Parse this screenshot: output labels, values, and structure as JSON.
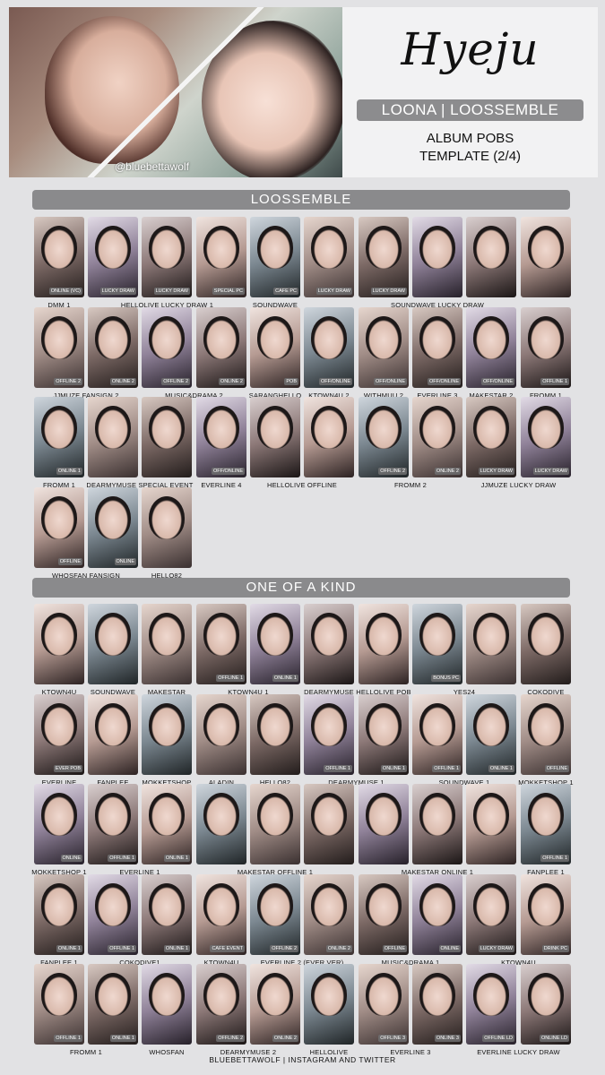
{
  "header": {
    "name": "Hyeju",
    "group": "LOONA | LOOSSEMBLE",
    "subtitle_line1": "ALBUM POBS",
    "subtitle_line2": "TEMPLATE (2/4)",
    "watermark": "@bluebettawolf"
  },
  "sections": [
    {
      "title": "LOOSSEMBLE",
      "rows": [
        {
          "tags": [
            "ONLINE (VC)",
            "LUCKY DRAW",
            "LUCKY DRAW",
            "SPECIAL PC",
            "CAFE PC",
            "LUCKY DRAW",
            "LUCKY DRAW",
            "",
            "",
            ""
          ],
          "labels": [
            {
              "text": "DMM 1",
              "span": [
                0,
                0
              ]
            },
            {
              "text": "HELLOLIVE LUCKY DRAW 1",
              "span": [
                1,
                3
              ]
            },
            {
              "text": "SOUNDWAVE",
              "span": [
                4,
                4
              ]
            },
            {
              "text": "SOUNDWAVE LUCKY DRAW",
              "span": [
                5,
                9
              ]
            }
          ]
        },
        {
          "tags": [
            "OFFLINE 2",
            "ONLINE 2",
            "OFFLINE 2",
            "ONLINE 2",
            "POB",
            "OFF/ONLINE",
            "OFF/ONLINE",
            "OFF/ONLINE",
            "OFF/ONLINE",
            "OFFLINE 1"
          ],
          "labels": [
            {
              "text": "JJMUZE FANSIGN 2",
              "span": [
                0,
                1
              ]
            },
            {
              "text": "MUSIC&DRAMA 2",
              "span": [
                2,
                3
              ]
            },
            {
              "text": "SARANGHELLO",
              "span": [
                4,
                4
              ]
            },
            {
              "text": "KTOWN4U 2",
              "span": [
                5,
                5
              ]
            },
            {
              "text": "WITHMUU 2",
              "span": [
                6,
                6
              ]
            },
            {
              "text": "EVERLINE 3",
              "span": [
                7,
                7
              ]
            },
            {
              "text": "MAKESTAR 2",
              "span": [
                8,
                8
              ]
            },
            {
              "text": "FROMM 1",
              "span": [
                9,
                9
              ]
            }
          ]
        },
        {
          "tags": [
            "ONLINE 1",
            "",
            "",
            "OFF/ONLINE",
            "",
            "",
            "OFFLINE 2",
            "ONLINE 2",
            "LUCKY DRAW",
            "LUCKY DRAW"
          ],
          "labels": [
            {
              "text": "FROMM 1",
              "span": [
                0,
                0
              ]
            },
            {
              "text": "DEARMYMUSE SPECIAL EVENT",
              "span": [
                1,
                2
              ]
            },
            {
              "text": "EVERLINE 4",
              "span": [
                3,
                3
              ]
            },
            {
              "text": "HELLOLIVE OFFLINE",
              "span": [
                4,
                5
              ]
            },
            {
              "text": "FROMM 2",
              "span": [
                6,
                7
              ]
            },
            {
              "text": "JJMUZE LUCKY DRAW",
              "span": [
                8,
                9
              ]
            }
          ]
        },
        {
          "tags": [
            "OFFLINE",
            "ONLINE",
            ""
          ],
          "labels": [
            {
              "text": "WHOSFAN FANSIGN",
              "span": [
                0,
                1
              ]
            },
            {
              "text": "HELLO82",
              "span": [
                2,
                2
              ]
            }
          ]
        }
      ]
    },
    {
      "title": "ONE OF A KIND",
      "rows": [
        {
          "tags": [
            "",
            "",
            "",
            "OFFLINE 1",
            "ONLINE 1",
            "",
            "",
            "BONUS PC",
            "",
            ""
          ],
          "labels": [
            {
              "text": "KTOWN4U",
              "span": [
                0,
                0
              ]
            },
            {
              "text": "SOUNDWAVE",
              "span": [
                1,
                1
              ]
            },
            {
              "text": "MAKESTAR",
              "span": [
                2,
                2
              ]
            },
            {
              "text": "KTOWN4U 1",
              "span": [
                3,
                4
              ]
            },
            {
              "text": "DEARMYMUSE",
              "span": [
                5,
                5
              ]
            },
            {
              "text": "HELLOLIVE POB",
              "span": [
                6,
                6
              ]
            },
            {
              "text": "YES24",
              "span": [
                7,
                8
              ]
            },
            {
              "text": "COKODIVE",
              "span": [
                9,
                9
              ]
            }
          ]
        },
        {
          "tags": [
            "EVER POB",
            "",
            "",
            "",
            "",
            "OFFLINE 1",
            "ONLINE 1",
            "OFFLINE 1",
            "ONLINE 1",
            "OFFLINE"
          ],
          "labels": [
            {
              "text": "EVERLINE",
              "span": [
                0,
                0
              ]
            },
            {
              "text": "FANPLEE",
              "span": [
                1,
                1
              ]
            },
            {
              "text": "MOKKETSHOP",
              "span": [
                2,
                2
              ]
            },
            {
              "text": "ALADIN",
              "span": [
                3,
                3
              ]
            },
            {
              "text": "HELLO82",
              "span": [
                4,
                4
              ]
            },
            {
              "text": "DEARMYMUSE 1",
              "span": [
                5,
                6
              ]
            },
            {
              "text": "SOUNDWAVE 1",
              "span": [
                7,
                8
              ]
            },
            {
              "text": "MOKKETSHOP 1",
              "span": [
                9,
                9
              ]
            }
          ]
        },
        {
          "tags": [
            "ONLINE",
            "OFFLINE 1",
            "ONLINE 1",
            "",
            "",
            "",
            "",
            "",
            "",
            "OFFLINE 1"
          ],
          "labels": [
            {
              "text": "MOKKETSHOP 1",
              "span": [
                0,
                0
              ]
            },
            {
              "text": "EVERLINE 1",
              "span": [
                1,
                2
              ]
            },
            {
              "text": "MAKESTAR OFFLINE 1",
              "span": [
                3,
                5
              ]
            },
            {
              "text": "MAKESTAR ONLINE 1",
              "span": [
                6,
                8
              ]
            },
            {
              "text": "FANPLEE 1",
              "span": [
                9,
                9
              ]
            }
          ]
        },
        {
          "tags": [
            "ONLINE 1",
            "OFFLINE 1",
            "ONLINE 1",
            "CAFE EVENT",
            "OFFLINE 2",
            "ONLINE 2",
            "OFFLINE",
            "ONLINE",
            "LUCKY DRAW",
            "DRINK PC"
          ],
          "labels": [
            {
              "text": "FANPLEE 1",
              "span": [
                0,
                0
              ]
            },
            {
              "text": "COKODIVE1",
              "span": [
                1,
                2
              ]
            },
            {
              "text": "KTOWN4U",
              "span": [
                3,
                3
              ]
            },
            {
              "text": "EVERLINE 2 (EVER VER)",
              "span": [
                4,
                5
              ]
            },
            {
              "text": "MUSIC&DRAMA 1",
              "span": [
                6,
                7
              ]
            },
            {
              "text": "KTOWN4U",
              "span": [
                8,
                9
              ]
            }
          ]
        },
        {
          "tags": [
            "OFFLINE 1",
            "ONLINE 1",
            "",
            "OFFLINE 2",
            "ONLINE 2",
            "",
            "OFFLINE 3",
            "ONLINE 3",
            "OFFLINE LD",
            "ONLINE LD"
          ],
          "labels": [
            {
              "text": "FROMM 1",
              "span": [
                0,
                1
              ]
            },
            {
              "text": "WHOSFAN",
              "span": [
                2,
                2
              ]
            },
            {
              "text": "DEARMYMUSE 2",
              "span": [
                3,
                4
              ]
            },
            {
              "text": "HELLOLIVE",
              "span": [
                5,
                5
              ]
            },
            {
              "text": "EVERLINE 3",
              "span": [
                6,
                7
              ]
            },
            {
              "text": "EVERLINE LUCKY DRAW",
              "span": [
                8,
                9
              ]
            }
          ]
        }
      ]
    }
  ],
  "footer": "BLUEBETTAWOLF | INSTAGRAM AND TWITTER"
}
